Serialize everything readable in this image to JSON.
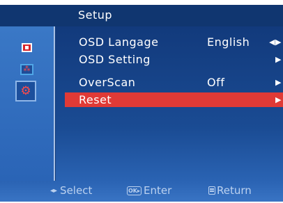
{
  "header": {
    "title": "Setup"
  },
  "sidebar": {
    "items": [
      {
        "icon": "display-icon",
        "selected": false
      },
      {
        "icon": "network-icon",
        "selected": false
      },
      {
        "icon": "gear-icon",
        "selected": true
      }
    ]
  },
  "menu": {
    "items": [
      {
        "label": "OSD Langage",
        "value": "English",
        "arrow": "◀▶"
      },
      {
        "label": "OSD Setting",
        "value": "",
        "arrow": "▶"
      },
      {
        "label": "OverScan",
        "value": "Off",
        "arrow": "▶"
      },
      {
        "label": "Reset",
        "value": "",
        "arrow": "▶",
        "highlighted": true
      }
    ]
  },
  "footer": {
    "select": {
      "glyph": "◂▸",
      "label": "Select"
    },
    "enter": {
      "glyph": "OK▸",
      "label": "Enter"
    },
    "return": {
      "label": "Return"
    }
  },
  "colors": {
    "panel": "#123a79",
    "highlight": "#e03a36",
    "sidebar": "#3a78c6",
    "text": "#ffffff"
  }
}
